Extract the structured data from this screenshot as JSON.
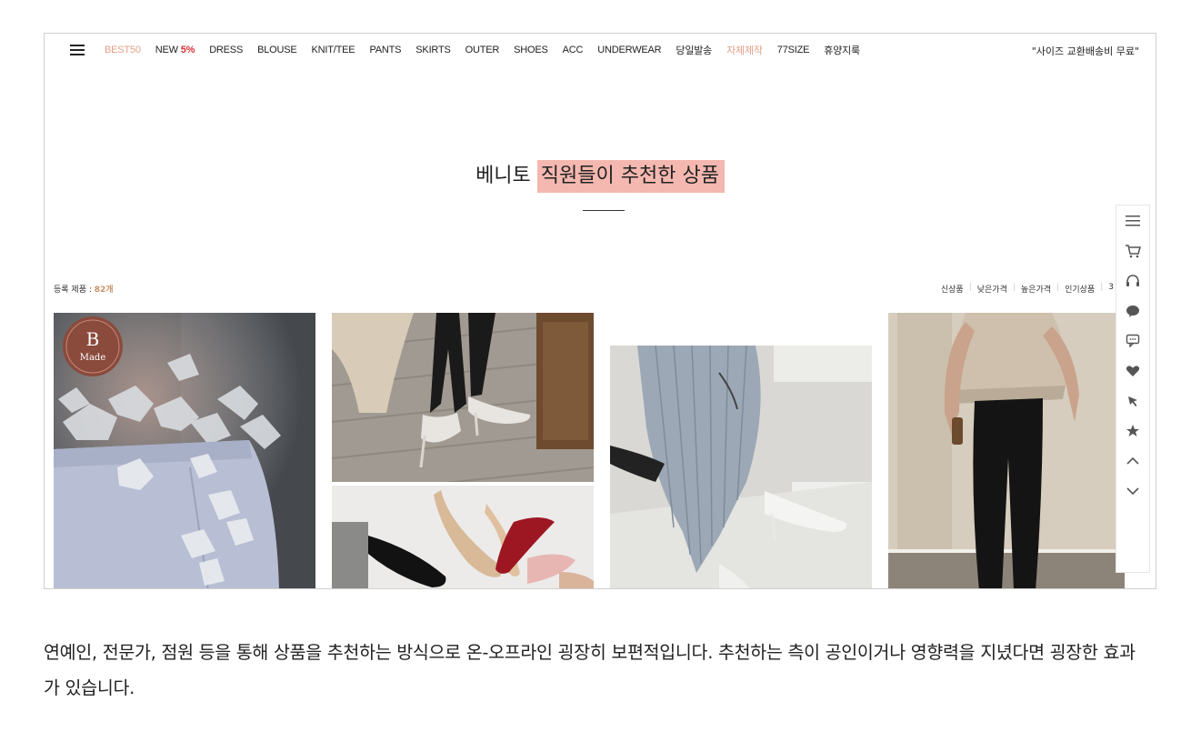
{
  "nav": {
    "items": [
      {
        "label": "BEST50",
        "accent": true
      },
      {
        "label": "NEW ",
        "suffix": "5%"
      },
      {
        "label": "DRESS"
      },
      {
        "label": "BLOUSE"
      },
      {
        "label": "KNIT/TEE"
      },
      {
        "label": "PANTS"
      },
      {
        "label": "SKIRTS"
      },
      {
        "label": "OUTER"
      },
      {
        "label": "SHOES"
      },
      {
        "label": "ACC"
      },
      {
        "label": "UNDERWEAR"
      },
      {
        "label": "당일발송"
      },
      {
        "label": "자체제작",
        "accent": true
      },
      {
        "label": "77SIZE"
      },
      {
        "label": "휴양지룩"
      }
    ],
    "promo": "\"사이즈 교환배송비 무료\""
  },
  "hero": {
    "title_plain": "베니토 ",
    "title_highlight": "직원들이 추천한 상품"
  },
  "listing": {
    "count_label": "등록 제품 : ",
    "count_value": "82개",
    "sort": [
      "신상품",
      "낮은가격",
      "높은가격",
      "인기상품",
      "3"
    ]
  },
  "badge": {
    "letter": "B",
    "text": "Made"
  },
  "sidebar": {
    "icons": [
      "menu-icon",
      "cart-icon",
      "headset-icon",
      "chat-icon",
      "message-icon",
      "heart-icon",
      "cursor-icon",
      "star-icon",
      "chevron-up-icon",
      "chevron-down-icon"
    ]
  },
  "colors": {
    "highlight": "#f4b8b0",
    "accent": "#e2a086",
    "new_pct": "#d6333a",
    "count": "#c99266"
  },
  "caption": {
    "text": "연예인, 전문가, 점원 등을 통해 상품을 추천하는 방식으로 온-오프라인 굉장히 보편적입니다. 추천하는 측이 공인이거나 영향력을 지녔다면 굉장한 효과가 있습니다."
  }
}
